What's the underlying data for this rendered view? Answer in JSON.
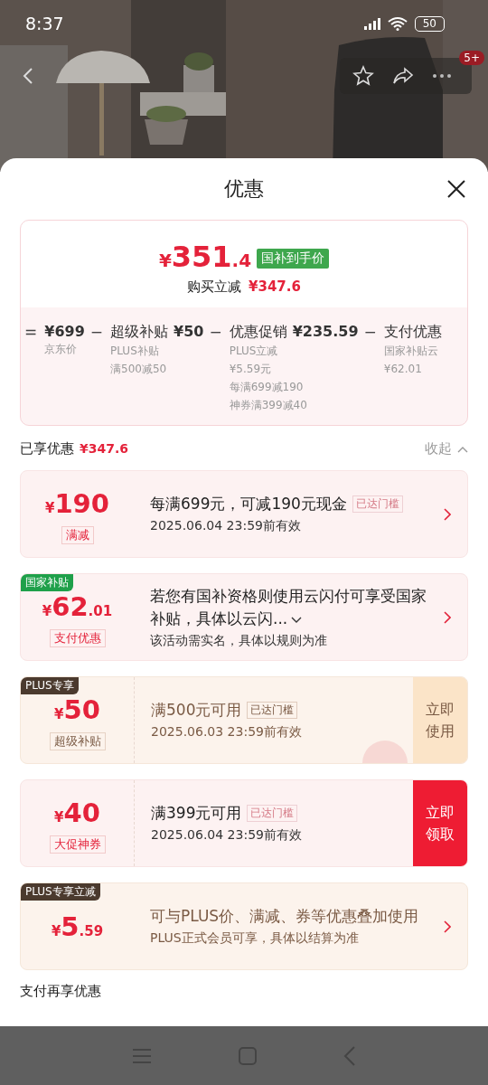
{
  "status_bar": {
    "time": "8:37",
    "battery": "50"
  },
  "header": {
    "badge": "5+"
  },
  "sheet": {
    "title": "优惠"
  },
  "summary": {
    "currency": "¥",
    "price_int": "351",
    "price_dec": ".4",
    "price_tag": "国补到手价",
    "saving_label": "购买立减",
    "saving": "¥347.6",
    "breakdown": [
      {
        "op": "=",
        "amount": "¥699",
        "notes": [
          "京东价"
        ]
      },
      {
        "op": "−",
        "title": "超级补贴",
        "amount": "¥50",
        "notes": [
          "PLUS补贴",
          "满500减50"
        ]
      },
      {
        "op": "−",
        "title": "优惠促销",
        "amount": "¥235.59",
        "notes": [
          "PLUS立减",
          "¥5.59元",
          "每满699减190",
          "神券满399减40"
        ]
      },
      {
        "op": "−",
        "title": "支付优惠",
        "notes": [
          "国家补贴云",
          "¥62.01"
        ]
      }
    ]
  },
  "enjoyed": {
    "label": "已享优惠",
    "amount": "¥347.6",
    "collapse": "收起",
    "expanded": true
  },
  "coupons": [
    {
      "kind": "arrow",
      "plus": false,
      "currency": "¥",
      "int": "190",
      "type": "满减",
      "title": "每满699元，可减190元现金",
      "reached": "已达门槛",
      "expandable": false,
      "lines": [
        "2025.06.04 23:59前有效"
      ]
    },
    {
      "kind": "arrow",
      "plus": false,
      "corner": "国家补贴",
      "color": "#1fa04a",
      "currency": "¥",
      "int": "62",
      "dec": ".01",
      "type": "支付优惠",
      "title": "若您有国补资格则使用云闪付可享受国家补贴，具体以云闪...",
      "expandable": true,
      "lines": [
        "该活动需实名，具体以规则为准"
      ]
    },
    {
      "kind": "button",
      "plus": true,
      "corner": "PLUS专享",
      "color": "#4b3a2e",
      "currency": "¥",
      "int": "50",
      "type": "超级补贴",
      "title": "满500元可用",
      "reached": "已达门槛",
      "expandable": false,
      "lines": [
        "2025.06.03 23:59前有效"
      ],
      "action": "立即使用",
      "stamp": true
    },
    {
      "kind": "button",
      "plus": false,
      "currency": "¥",
      "int": "40",
      "type": "大促神券",
      "title": "满399元可用",
      "reached": "已达门槛",
      "expandable": false,
      "lines": [
        "2025.06.04 23:59前有效"
      ],
      "action": "立即领取",
      "stamp": false
    },
    {
      "kind": "arrow",
      "plus": true,
      "corner": "PLUS专享立减",
      "color": "#4b3a2e",
      "currency": "¥",
      "int": "5",
      "dec": ".59",
      "title": "可与PLUS价、满减、券等优惠叠加使用",
      "expandable": false,
      "lines": [
        "PLUS正式会员可享，具体以结算为准"
      ]
    }
  ],
  "footer": {
    "label": "支付再享优惠"
  }
}
